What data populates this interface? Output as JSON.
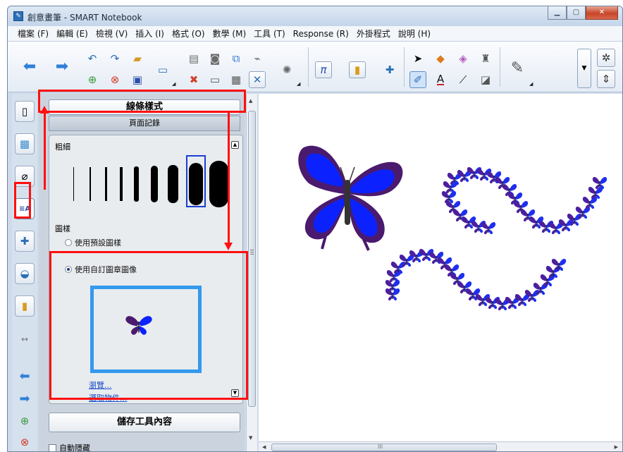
{
  "window": {
    "app_icon": "notebook-icon",
    "title": "創意畫筆 - SMART Notebook",
    "controls": {
      "minimize": "▁",
      "maximize": "▢",
      "close": "✕"
    }
  },
  "menubar": {
    "items": [
      "檔案 (F)",
      "編輯 (E)",
      "檢視 (V)",
      "插入 (I)",
      "格式 (O)",
      "數學 (M)",
      "工具 (T)",
      "Response (R)",
      "外掛程式",
      "說明 (H)"
    ]
  },
  "toolbar": {
    "icons": [
      "back-arrow-icon",
      "forward-arrow-icon",
      "undo-icon",
      "redo-icon",
      "open-file-icon",
      "new-page-icon",
      "delete-page-icon",
      "save-icon",
      "screen-shade-icon",
      "paste-icon",
      "delete-icon",
      "capture-icon",
      "table-icon",
      "screen-capture-icon",
      "clear-ink-icon",
      "magic-pen-icon",
      "math-icon",
      "response-icon",
      "addon-icon",
      "select-arrow-icon",
      "shapes-icon",
      "eraser-icon",
      "fill-icon",
      "creative-pen-icon",
      "text-icon",
      "line-icon",
      "eraser-tool-icon",
      "pen-properties-icon",
      "gear-icon",
      "move-toolbar-icon"
    ]
  },
  "tabs": [
    "page-sorter-icon",
    "gallery-icon",
    "attachments-icon",
    "properties-icon",
    "addons-icon",
    "lesson-activity-icon",
    "response-tab-icon"
  ],
  "panel": {
    "properties_title": "線條樣式",
    "page_recording": "頁面記錄",
    "thickness_label": "粗細",
    "pattern_label": "圖樣",
    "use_default_pattern": "使用預設圖樣",
    "use_custom_stamp": "使用自訂圖章圖像",
    "browse_link": "瀏覽...",
    "select_object_link": "選取物件...",
    "save_tool": "儲存工具內容",
    "auto_hide": "自動隱藏"
  },
  "canvas": {
    "scrollbar_glyph": "III"
  },
  "colors": {
    "annotation": "#ff1010",
    "stamp_frame": "#3399ee",
    "butterfly_blue": "#0b22ff",
    "butterfly_purple": "#4a1a6e"
  }
}
